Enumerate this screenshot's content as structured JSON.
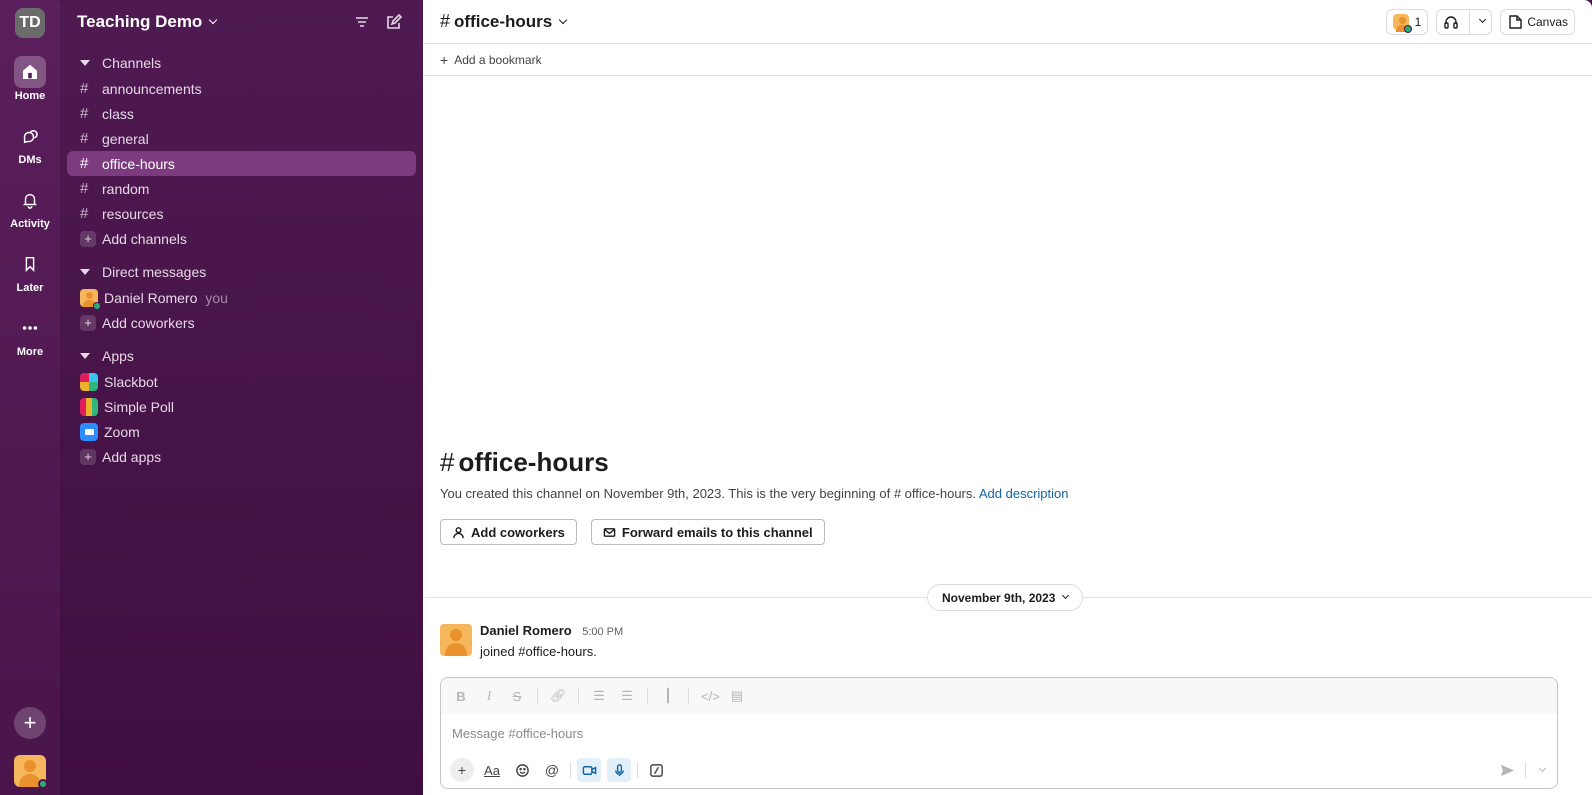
{
  "workspace": {
    "initials": "TD",
    "name": "Teaching Demo"
  },
  "rail": {
    "items": [
      {
        "label": "Home"
      },
      {
        "label": "DMs"
      },
      {
        "label": "Activity"
      },
      {
        "label": "Later"
      },
      {
        "label": "More"
      }
    ]
  },
  "sidebar": {
    "channels_title": "Channels",
    "channels": [
      {
        "name": "announcements"
      },
      {
        "name": "class"
      },
      {
        "name": "general"
      },
      {
        "name": "office-hours"
      },
      {
        "name": "random"
      },
      {
        "name": "resources"
      }
    ],
    "add_channels": "Add channels",
    "dms_title": "Direct messages",
    "dm_user": "Daniel Romero",
    "dm_you": "you",
    "add_coworkers": "Add coworkers",
    "apps_title": "Apps",
    "apps": [
      {
        "name": "Slackbot"
      },
      {
        "name": "Simple Poll"
      },
      {
        "name": "Zoom"
      }
    ],
    "add_apps": "Add apps"
  },
  "header": {
    "hash": "#",
    "channel": "office-hours",
    "member_count": "1",
    "canvas_label": "Canvas",
    "add_bookmark": "Add a bookmark"
  },
  "intro": {
    "hash": "#",
    "title": "office-hours",
    "text": "You created this channel on November 9th, 2023. This is the very beginning of # office-hours.",
    "add_description": "Add description",
    "btn_add_coworkers": "Add coworkers",
    "btn_forward": "Forward emails to this channel"
  },
  "date_divider": "November 9th, 2023",
  "message": {
    "author": "Daniel Romero",
    "time": "5:00 PM",
    "text": "joined #office-hours."
  },
  "composer": {
    "placeholder": "Message #office-hours"
  }
}
